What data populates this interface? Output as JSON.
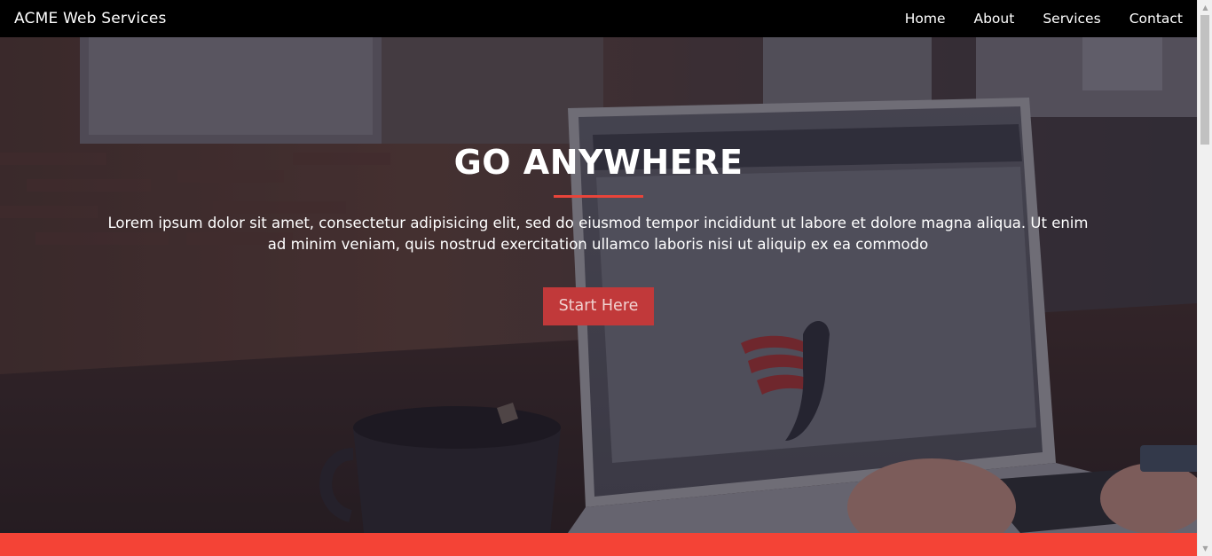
{
  "navbar": {
    "brand": "ACME Web Services",
    "links": [
      {
        "label": "Home"
      },
      {
        "label": "About"
      },
      {
        "label": "Services"
      },
      {
        "label": "Contact"
      }
    ]
  },
  "hero": {
    "title": "GO ANYWHERE",
    "text": "Lorem ipsum dolor sit amet, consectetur adipisicing elit, sed do eiusmod tempor incididunt ut labore et dolore magna aliqua. Ut enim ad minim veniam, quis nostrud exercitation ullamco laboris nisi ut aliquip ex ea commodo",
    "button_label": "Start Here",
    "background_image": "laptop-on-desk-photo"
  },
  "colors": {
    "navbar": "#000000",
    "accent": "#f44336",
    "button": "#c1393a"
  },
  "icons": {
    "scroll_up": "chevron-up-icon",
    "scroll_down": "chevron-down-icon"
  }
}
